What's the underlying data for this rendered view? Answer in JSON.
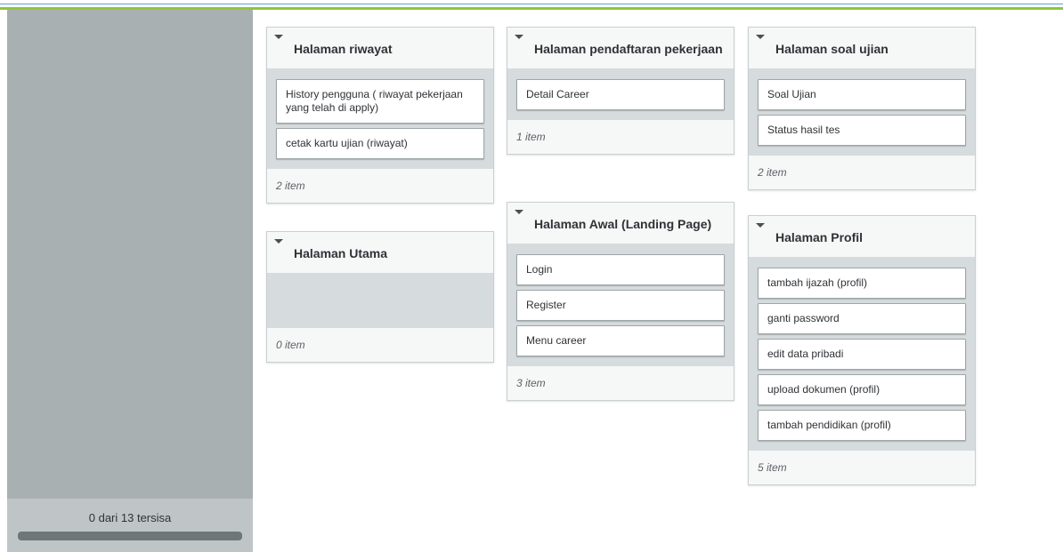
{
  "sidebar": {
    "remaining_text": "0 dari 13 tersisa",
    "progress_fraction": 0
  },
  "columns": [
    {
      "cards": [
        {
          "title": "Halaman riwayat",
          "items": [
            "History pengguna ( riwayat pekerjaan yang telah di apply)",
            "cetak kartu ujian (riwayat)"
          ],
          "count_label": "2 item"
        },
        {
          "title": "Halaman Utama",
          "items": [],
          "count_label": "0 item"
        }
      ]
    },
    {
      "cards": [
        {
          "title": "Halaman pendaftaran pekerjaan",
          "items": [
            "Detail Career"
          ],
          "count_label": "1 item"
        },
        {
          "title": "Halaman Awal (Landing Page)",
          "items": [
            "Login",
            "Register",
            "Menu career"
          ],
          "count_label": "3 item"
        }
      ]
    },
    {
      "cards": [
        {
          "title": "Halaman soal ujian",
          "items": [
            "Soal Ujian",
            "Status hasil tes"
          ],
          "count_label": "2 item"
        },
        {
          "title": "Halaman Profil",
          "items": [
            "tambah ijazah (profil)",
            "ganti password",
            "edit data pribadi",
            "upload dokumen (profil)",
            "tambah pendidikan (profil)"
          ],
          "count_label": "5 item"
        }
      ]
    }
  ]
}
